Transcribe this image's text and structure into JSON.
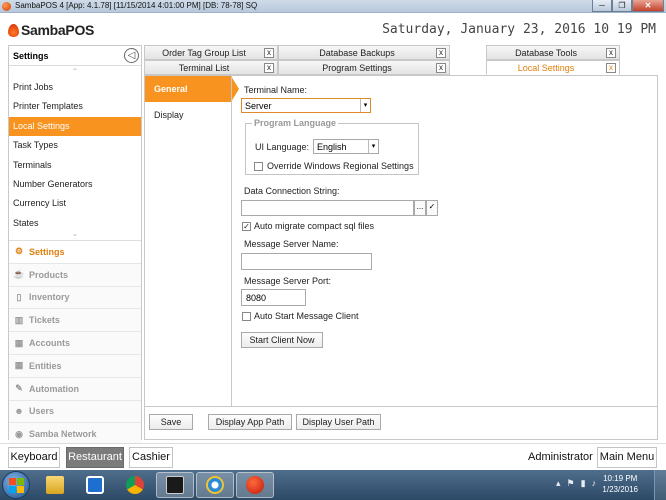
{
  "window": {
    "title": "SambaPOS 4 [App: 4.1.78] [11/15/2014 4:01:00 PM] [DB: 78-78] SQ",
    "minimize": "─",
    "restore": "❐",
    "close": "✕"
  },
  "header": {
    "logo": "SambaPOS",
    "datetime": "Saturday, January 23, 2016 10 19 PM"
  },
  "sidebar": {
    "title": "Settings",
    "back_icon": "◁",
    "scroll_up": "⌃",
    "scroll_down": "⌄",
    "items": [
      "Print Jobs",
      "Printer Templates",
      "Local Settings",
      "Task Types",
      "Terminals",
      "Number Generators",
      "Currency List",
      "States"
    ],
    "active_item": "Local Settings",
    "sections": [
      {
        "label": "Settings",
        "icon": "⚙"
      },
      {
        "label": "Products",
        "icon": "☕"
      },
      {
        "label": "Inventory",
        "icon": "▯"
      },
      {
        "label": "Tickets",
        "icon": "▥"
      },
      {
        "label": "Accounts",
        "icon": "▦"
      },
      {
        "label": "Entities",
        "icon": "▦"
      },
      {
        "label": "Automation",
        "icon": "✎"
      },
      {
        "label": "Users",
        "icon": "☻"
      },
      {
        "label": "Samba Network",
        "icon": "◉"
      }
    ]
  },
  "tabs": {
    "row1": [
      "Order Tag Group List",
      "Database Backups",
      "Database Tools"
    ],
    "row2": [
      "Terminal List",
      "Program Settings",
      "Local Settings"
    ],
    "active": "Local Settings",
    "close_glyph": "x"
  },
  "subnav": {
    "items": [
      "General",
      "Display"
    ],
    "active": "General"
  },
  "form": {
    "terminal_name_label": "Terminal Name:",
    "terminal_name_value": "Server",
    "program_language_group": "Program Language",
    "ui_language_label": "UI Language:",
    "ui_language_value": "English",
    "override_regional_label": "Override Windows Regional Settings",
    "override_regional_checked": false,
    "data_connection_label": "Data Connection String:",
    "data_connection_value": "",
    "browse_glyph": "...",
    "confirm_glyph": "✓",
    "auto_migrate_label": "Auto migrate compact sql files",
    "auto_migrate_checked": true,
    "message_server_name_label": "Message Server Name:",
    "message_server_name_value": "",
    "message_server_port_label": "Message Server Port:",
    "message_server_port_value": "8080",
    "auto_start_label": "Auto Start Message Client",
    "auto_start_checked": false,
    "start_client_button": "Start Client Now",
    "dropdown_glyph": "▾",
    "check_glyph": "✓"
  },
  "footer": {
    "save": "Save",
    "display_app_path": "Display App Path",
    "display_user_path": "Display User Path"
  },
  "bottombar": {
    "keyboard": "Keyboard",
    "restaurant": "Restaurant",
    "cashier": "Cashier",
    "active": "Restaurant",
    "user": "Administrator",
    "main_menu": "Main Menu"
  },
  "taskbar": {
    "apps": [
      {
        "name": "Windows Explorer",
        "icon": "folder-icon"
      },
      {
        "name": "TeamViewer",
        "icon": "teamviewer-icon"
      },
      {
        "name": "Chrome",
        "icon": "chrome-icon"
      },
      {
        "name": "Terminal",
        "icon": "terminal-icon"
      },
      {
        "name": "Internet Explorer",
        "icon": "ie-icon"
      },
      {
        "name": "SambaPOS",
        "icon": "sambapos-icon"
      }
    ],
    "tray": [
      "▴",
      "⚑",
      "▮",
      "♪"
    ],
    "clock_time": "10:19 PM",
    "clock_date": "1/23/2016"
  },
  "colors": {
    "accent": "#f7931e",
    "accent_text": "#e07f0d",
    "bottom_active": "#7b7b7b"
  }
}
